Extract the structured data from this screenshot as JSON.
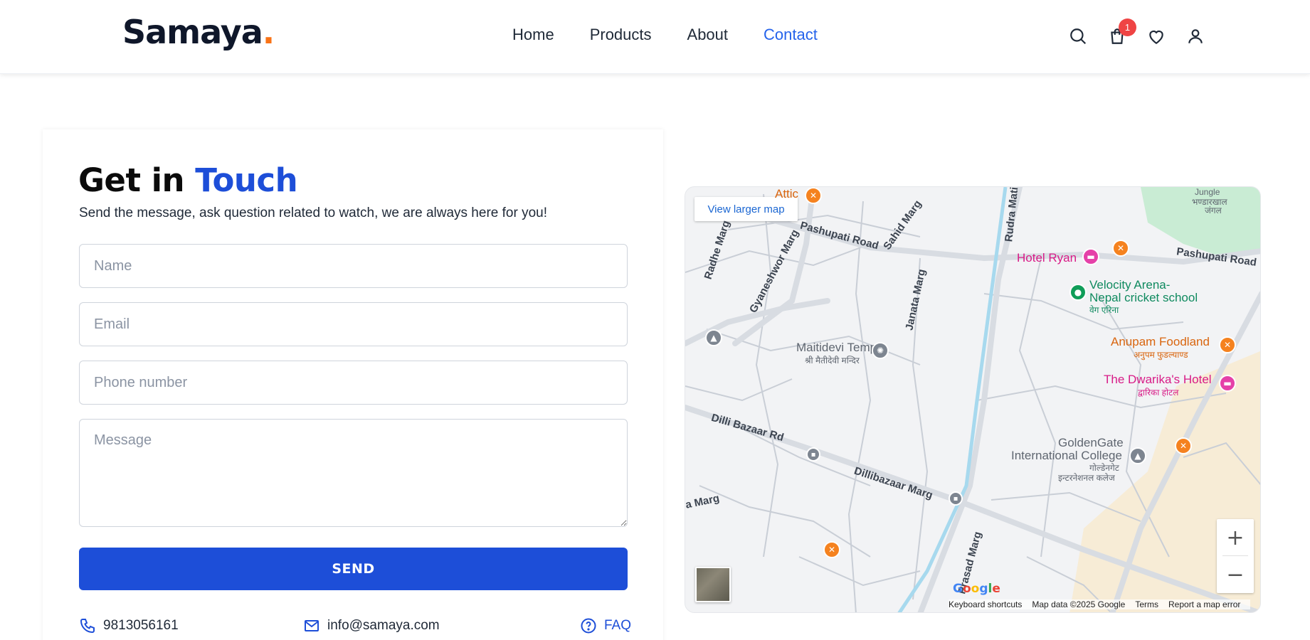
{
  "brand": {
    "name": "Samaya",
    "dot": "."
  },
  "nav": {
    "items": [
      {
        "label": "Home"
      },
      {
        "label": "Products"
      },
      {
        "label": "About"
      },
      {
        "label": "Contact",
        "active": true
      }
    ]
  },
  "header_icons": {
    "cart_count": "1"
  },
  "contact": {
    "title_prefix": "Get in ",
    "title_accent": "Touch",
    "subtitle": "Send the message, ask question related to watch, we are always here for you!",
    "name_placeholder": "Name",
    "email_placeholder": "Email",
    "phone_placeholder": "Phone number",
    "message_placeholder": "Message",
    "send_label": "SEND",
    "phone": "9813056161",
    "email": "info@samaya.com",
    "faq": "FAQ"
  },
  "map": {
    "view_larger": "View larger map",
    "roads": {
      "pashupati_road": "Pashupati Road",
      "pashupati_road_right": "Pashupati Road",
      "radhe_marg": "Radhe Marg",
      "gyaneshwor_marg": "Gyaneshwor Marg",
      "sahid_marg": "Sahid Marg",
      "janata_marg": "Janata Marg",
      "rudra_mati": "Rudra Mati",
      "dilli_bazaar_rd": "Dilli Bazaar Rd",
      "dillibazaar_marg": "Dillibazaar Marg",
      "a_marg": "a Marg",
      "prasad_marg": "Prasad Marg"
    },
    "places": {
      "attic": "Attic",
      "hotel_ryan": "Hotel Ryan",
      "velocity_arena_1": "Velocity Arena-",
      "velocity_arena_2": "Nepal cricket school",
      "velocity_arena_np": "वेग एरिना",
      "jungle_1": "Jungle",
      "jungle_2": "भण्डारखाल",
      "jungle_3": "जंगल",
      "anupam": "Anupam Foodland",
      "anupam_np": "अनुपम फुडल्याण्ड",
      "dwarika": "The Dwarika's Hotel",
      "dwarika_np": "द्वारिका होटल",
      "maitidevi": "Maitidevi Temple",
      "maitidevi_np": "श्री मैतीदेवी मन्दिर",
      "goldengate_1": "GoldenGate",
      "goldengate_2": "International College",
      "goldengate_np1": "गोल्डेनगेट",
      "goldengate_np2": "इन्टरनेशनल कलेज"
    },
    "google": "Google",
    "attribution": [
      "Keyboard shortcuts",
      "Map data ©2025 Google",
      "Terms",
      "Report a map error"
    ]
  }
}
